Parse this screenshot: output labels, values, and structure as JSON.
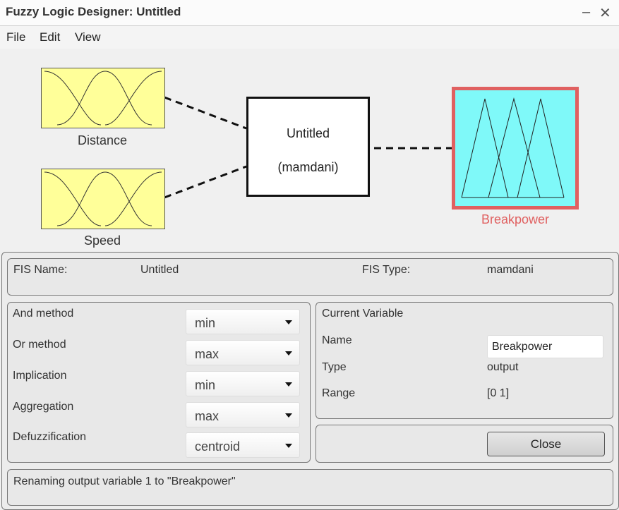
{
  "window": {
    "title": "Fuzzy Logic Designer: Untitled"
  },
  "menu": {
    "file": "File",
    "edit": "Edit",
    "view": "View"
  },
  "diagram": {
    "inputs": [
      {
        "name": "Distance"
      },
      {
        "name": "Speed"
      }
    ],
    "system": {
      "name": "Untitled",
      "type_label": "(mamdani)"
    },
    "output": {
      "name": "Breakpower"
    },
    "colors": {
      "input_fill": "#ffff99",
      "output_fill": "#7ff9f9",
      "output_border": "#e06060",
      "output_label": "#e06060"
    }
  },
  "fis": {
    "name_label": "FIS Name:",
    "name_value": "Untitled",
    "type_label": "FIS Type:",
    "type_value": "mamdani"
  },
  "methods": [
    {
      "label": "And method",
      "value": "min"
    },
    {
      "label": "Or method",
      "value": "max"
    },
    {
      "label": "Implication",
      "value": "min"
    },
    {
      "label": "Aggregation",
      "value": "max"
    },
    {
      "label": "Defuzzification",
      "value": "centroid"
    }
  ],
  "current_variable": {
    "title": "Current Variable",
    "name_label": "Name",
    "name_value": "Breakpower",
    "type_label": "Type",
    "type_value": "output",
    "range_label": "Range",
    "range_value": "[0 1]"
  },
  "close_label": "Close",
  "status": "Renaming output variable 1 to \"Breakpower\""
}
